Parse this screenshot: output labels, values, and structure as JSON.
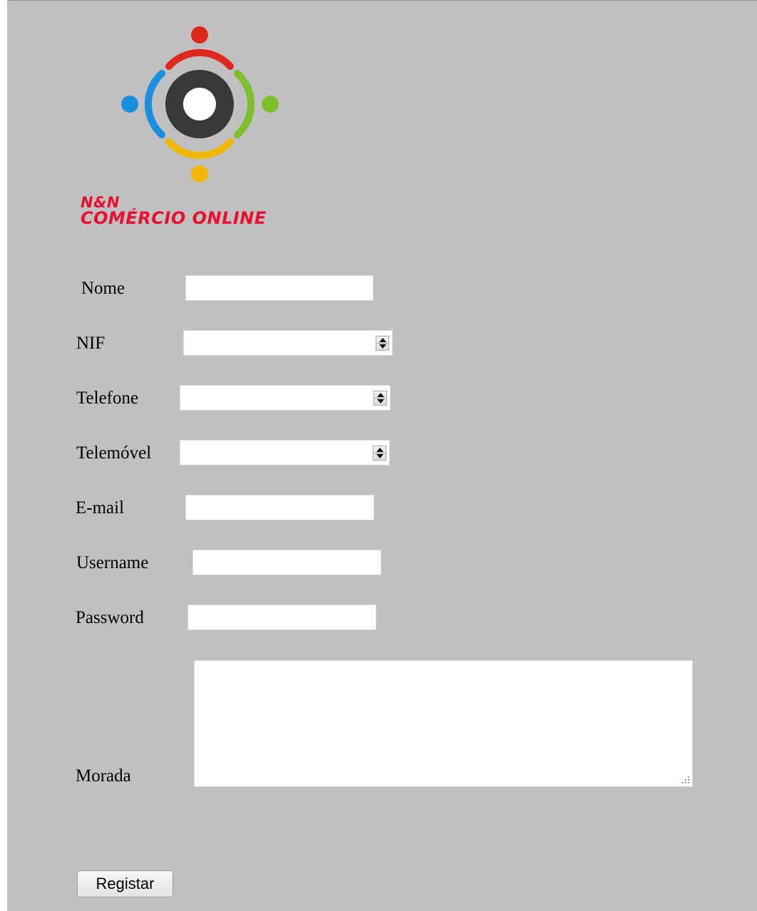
{
  "brand": {
    "line1": "N&N",
    "line2": "COMÉRCIO ONLINE",
    "color": "#e8102e"
  },
  "logo": {
    "icon": "community-circle-logo",
    "colors": {
      "top": "#e0271e",
      "left": "#1a8fe0",
      "right": "#7ebf2b",
      "bottom": "#f2b705",
      "center": "#3a3838"
    }
  },
  "form": {
    "nome": {
      "label": "Nome",
      "value": ""
    },
    "nif": {
      "label": "NIF",
      "value": ""
    },
    "telefone": {
      "label": "Telefone",
      "value": ""
    },
    "telemovel": {
      "label": "Telemóvel",
      "value": ""
    },
    "email": {
      "label": "E-mail",
      "value": ""
    },
    "username": {
      "label": "Username",
      "value": ""
    },
    "password": {
      "label": "Password",
      "value": ""
    },
    "morada": {
      "label": "Morada",
      "value": ""
    },
    "submit_label": "Registar"
  },
  "colors": {
    "page_background": "#c0c0c0"
  }
}
